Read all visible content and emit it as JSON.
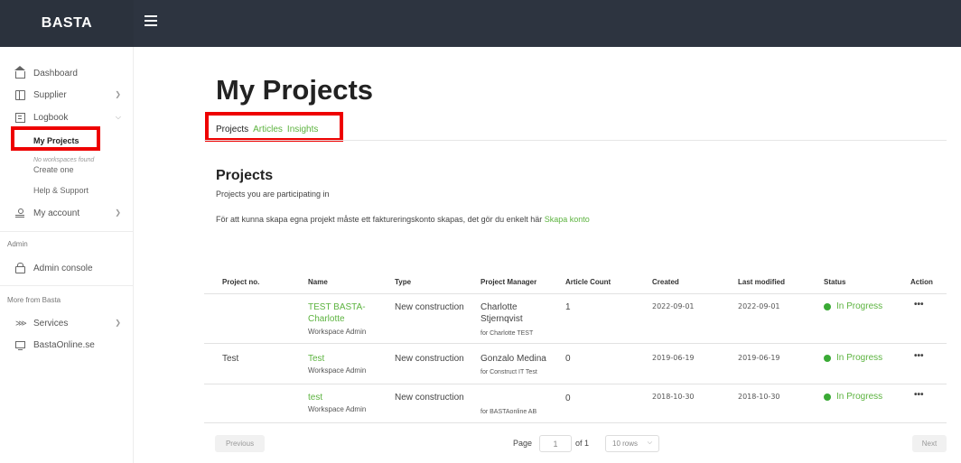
{
  "app": {
    "brand": "BASTA"
  },
  "sidebar": {
    "dashboard": "Dashboard",
    "supplier": "Supplier",
    "logbook": "Logbook",
    "my_projects": "My Projects",
    "no_workspaces": "No workspaces found",
    "create_one": "Create one",
    "help_support": "Help & Support",
    "my_account": "My account",
    "admin_label": "Admin",
    "admin_console": "Admin console",
    "more_label": "More from Basta",
    "services": "Services",
    "bastaonline": "BastaOnline.se",
    "icons": [
      "home-icon",
      "supplier-icon",
      "logbook-icon",
      "user-icon",
      "lock-icon",
      "services-icon",
      "monitor-icon"
    ]
  },
  "main": {
    "title": "My Projects",
    "tabs": [
      {
        "label": "Projects",
        "active": true
      },
      {
        "label": "Articles",
        "active": false
      },
      {
        "label": "Insights",
        "active": false
      }
    ],
    "section_title": "Projects",
    "section_subtitle": "Projects you are participating in",
    "notice_text": "För att kunna skapa egna projekt måste ett faktureringskonto skapas, det gör du enkelt här",
    "notice_link": "Skapa konto"
  },
  "table": {
    "headers": [
      "Project no.",
      "Name",
      "Type",
      "Project Manager",
      "Article Count",
      "Created",
      "Last modified",
      "Status",
      "Action"
    ],
    "rows": [
      {
        "project_no": "",
        "name_line1": "TEST BASTA-",
        "name_line2": "Charlotte",
        "role": "Workspace Admin",
        "type": "New construction",
        "manager_line1": "Charlotte",
        "manager_line2": "Stjernqvist",
        "manager_org": "for Charlotte TEST",
        "article_count": "1",
        "created": "2022-09-01",
        "modified": "2022-09-01",
        "status": "In Progress",
        "action": "•••"
      },
      {
        "project_no": "Test",
        "name_line1": "Test",
        "name_line2": "",
        "role": "Workspace Admin",
        "type": "New construction",
        "manager_line1": "Gonzalo Medina",
        "manager_line2": "",
        "manager_org": "for Construct IT Test",
        "article_count": "0",
        "created": "2019-06-19",
        "modified": "2019-06-19",
        "status": "In Progress",
        "action": "•••"
      },
      {
        "project_no": "",
        "name_line1": "test",
        "name_line2": "",
        "role": "Workspace Admin",
        "type": "New construction",
        "manager_line1": "",
        "manager_line2": "",
        "manager_org": "for BASTAonline AB",
        "article_count": "0",
        "created": "2018-10-30",
        "modified": "2018-10-30",
        "status": "In Progress",
        "action": "•••"
      }
    ]
  },
  "pagination": {
    "previous": "Previous",
    "page_label": "Page",
    "page_value": "1",
    "of_label": "of 1",
    "rows_select": "10 rows",
    "next": "Next"
  },
  "colors": {
    "topbar": "#2d3440",
    "accent": "#5cb33f",
    "status_dot": "#3aaa35",
    "highlight": "#e00000"
  }
}
